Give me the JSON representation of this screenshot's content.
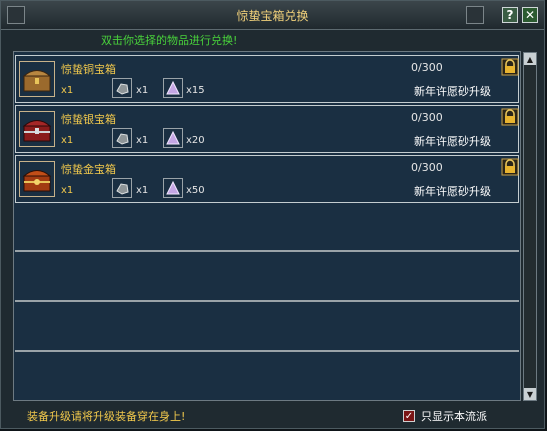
{
  "window": {
    "title": "惊蛰宝箱兑换",
    "help_label": "?",
    "close_label": "✕"
  },
  "instruction": "双击你选择的物品进行兑换!",
  "items": [
    {
      "name": "惊蛰铜宝箱",
      "qty": "x1",
      "mat1_count": "x1",
      "mat2_count": "x15",
      "progress": "0/300",
      "upgrade": "新年许愿砂升级",
      "chest_color": "#9b6a2d"
    },
    {
      "name": "惊蛰银宝箱",
      "qty": "x1",
      "mat1_count": "x1",
      "mat2_count": "x20",
      "progress": "0/300",
      "upgrade": "新年许愿砂升级",
      "chest_color": "#8a1c1c"
    },
    {
      "name": "惊蛰金宝箱",
      "qty": "x1",
      "mat1_count": "x1",
      "mat2_count": "x50",
      "progress": "0/300",
      "upgrade": "新年许愿砂升级",
      "chest_color": "#a23b12"
    }
  ],
  "footer": {
    "tip": "装备升级请将升级装备穿在身上!",
    "filter_label": "只显示本流派",
    "filter_checked": true
  },
  "colors": {
    "accent_gold": "#f2c94c",
    "instruction_green": "#49d33b",
    "list_bg": "#1a2f42"
  }
}
